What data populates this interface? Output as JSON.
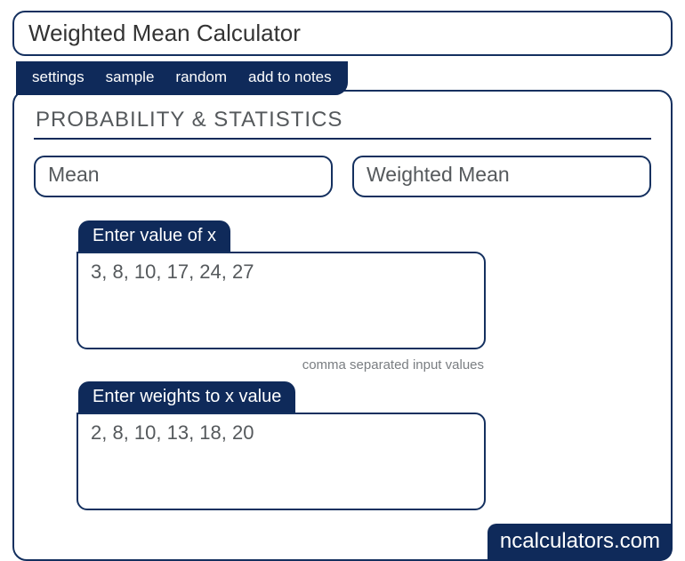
{
  "title": "Weighted Mean Calculator",
  "tabs": {
    "settings": "settings",
    "sample": "sample",
    "random": "random",
    "add_notes": "add to notes"
  },
  "section": "PROBABILITY & STATISTICS",
  "mini_tabs": {
    "mean": "Mean",
    "weighted": "Weighted Mean"
  },
  "fields": {
    "x": {
      "label": "Enter value of x",
      "value": "3, 8, 10, 17, 24, 27",
      "helper": "comma separated input values"
    },
    "w": {
      "label": "Enter weights to x value",
      "value": "2, 8, 10, 13, 18, 20"
    }
  },
  "brand": "ncalculators.com"
}
